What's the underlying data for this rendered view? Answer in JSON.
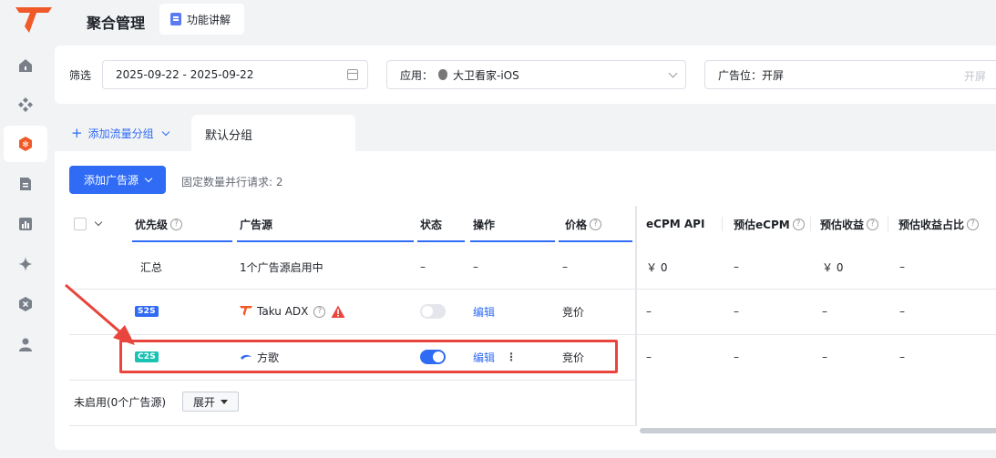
{
  "header": {
    "title": "聚合管理",
    "feature_button": "功能讲解"
  },
  "filters": {
    "label": "筛选",
    "date_range": "2025-09-22 - 2025-09-22",
    "app_label": "应用：",
    "app_value": "大卫看家-iOS",
    "slot_label": "广告位：开屏",
    "slot_value": "开屏"
  },
  "groups": {
    "add_label": "添加流量分组",
    "active_tab": "默认分组"
  },
  "toolbar": {
    "add_source_label": "添加广告源",
    "concurrency_text": "固定数量并行请求: 2"
  },
  "table": {
    "headers": {
      "priority": "优先级",
      "source": "广告源",
      "status": "状态",
      "action": "操作",
      "price": "价格",
      "ecpm_api": "eCPM API",
      "est_ecpm": "预估eCPM",
      "est_revenue": "预估收益",
      "est_share": "预估收益占比"
    },
    "summary": {
      "label": "汇总",
      "source": "1个广告源启用中",
      "status": "–",
      "action": "–",
      "price": "–",
      "ecpm_api": "￥ 0",
      "est_ecpm": "–",
      "est_revenue": "￥ 0",
      "est_share": "–"
    },
    "rows": [
      {
        "badge": "S2S",
        "source": "Taku ADX",
        "status": "off",
        "action": "编辑",
        "price": "竞价",
        "ecpm_api": "–",
        "est_ecpm": "–",
        "est_revenue": "–",
        "est_share": "–"
      },
      {
        "badge": "C2S",
        "source": "方歌",
        "status": "on",
        "action": "编辑",
        "price": "竞价",
        "ecpm_api": "–",
        "est_ecpm": "–",
        "est_revenue": "–",
        "est_share": "–"
      }
    ],
    "disabled_label": "未启用(0个广告源)",
    "expand_label": "展开"
  },
  "colors": {
    "accent": "#2f6bf5",
    "brand": "#f05a28",
    "annotation": "#e8453c"
  }
}
